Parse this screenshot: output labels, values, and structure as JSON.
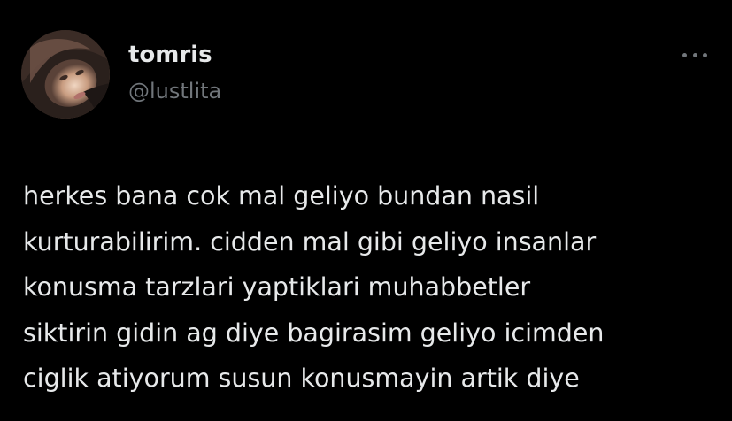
{
  "author": {
    "display_name": "tomris",
    "handle": "@lustlita",
    "avatar_icon": "profile-photo"
  },
  "tweet": {
    "lines": [
      "herkes bana cok mal geliyo bundan nasil",
      "kurturabilirim. cidden mal gibi geliyo insanlar",
      "konusma tarzlari yaptiklari muhabbetler",
      "siktirin gidin ag diye bagirasim geliyo icimden",
      "ciglik atiyorum susun konusmayin artik diye"
    ]
  },
  "menu": {
    "icon": "more-horizontal-icon"
  },
  "colors": {
    "background": "#000000",
    "primary_text": "#e7e9ea",
    "secondary_text": "#71767b"
  }
}
